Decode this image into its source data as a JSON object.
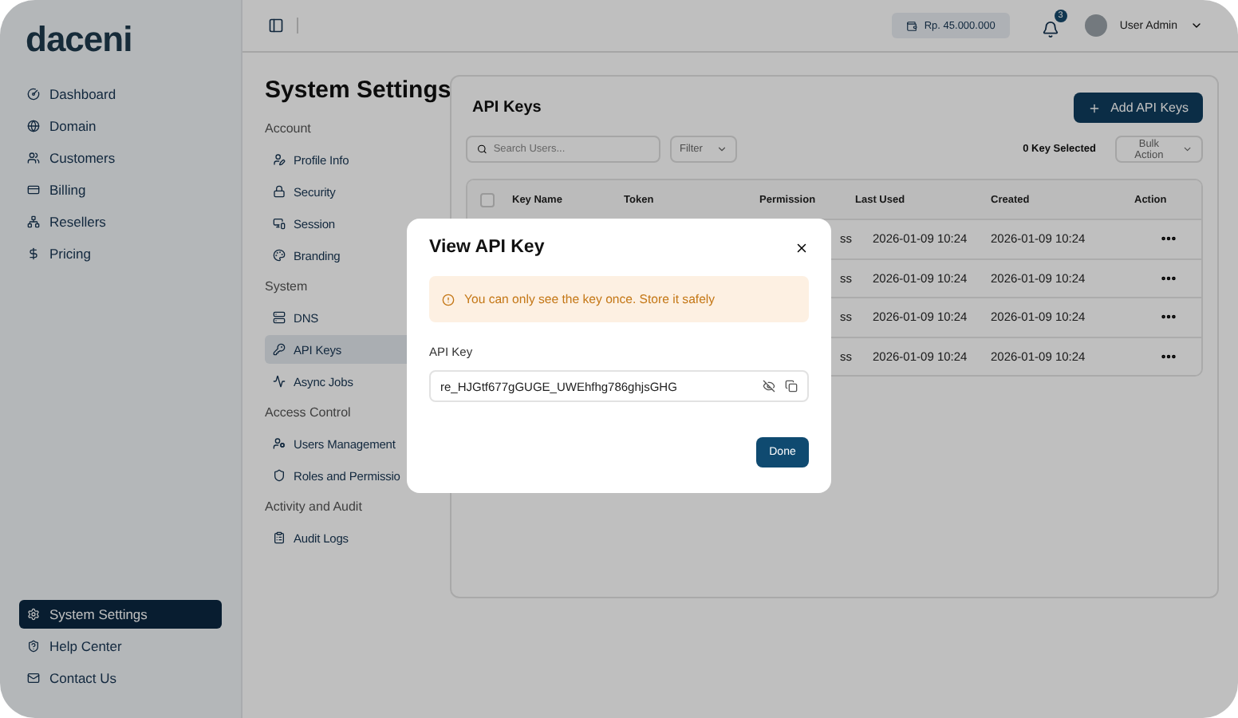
{
  "sidebar": {
    "logo": "daceni",
    "items": [
      {
        "label": "Dashboard",
        "selected": false
      },
      {
        "label": "Domain",
        "selected": false
      },
      {
        "label": "Customers",
        "selected": false
      },
      {
        "label": "Billing",
        "selected": false
      },
      {
        "label": "Resellers",
        "selected": false
      },
      {
        "label": "Pricing",
        "selected": false
      }
    ],
    "bottom_items": [
      {
        "label": "System Settings",
        "selected": true
      },
      {
        "label": "Help Center",
        "selected": false
      },
      {
        "label": "Contact Us",
        "selected": false
      }
    ]
  },
  "header": {
    "balance": "Rp. 45.000.000",
    "notification_count": "3",
    "user": "User Admin"
  },
  "settings_nav": {
    "title": "System Settings",
    "groups": [
      {
        "title": "Account",
        "items": [
          {
            "label": "Profile Info",
            "selected": false
          },
          {
            "label": "Security",
            "selected": false
          },
          {
            "label": "Session",
            "selected": false
          },
          {
            "label": "Branding",
            "selected": false
          }
        ]
      },
      {
        "title": "System",
        "items": [
          {
            "label": "DNS",
            "selected": false
          },
          {
            "label": "API Keys",
            "selected": true
          },
          {
            "label": "Async Jobs",
            "selected": false
          }
        ]
      },
      {
        "title": "Access Control",
        "items": [
          {
            "label": "Users Management",
            "selected": false
          },
          {
            "label": "Roles and Permissio",
            "selected": false
          }
        ]
      },
      {
        "title": "Activity and Audit",
        "items": [
          {
            "label": "Audit Logs",
            "selected": false
          }
        ]
      }
    ]
  },
  "panel": {
    "title": "API Keys",
    "add_button": "Add API Keys",
    "search": {
      "placeholder": "Search Users..."
    },
    "filter": "Filter",
    "selected_count": "0 Key Selected",
    "bulk_action": "Bulk Action",
    "table": {
      "all_checked": false,
      "columns": [
        "Key Name",
        "Token",
        "Permission",
        "Last Used",
        "Created",
        "Action"
      ],
      "rows": [
        {
          "permission": "ss",
          "last_used": "2026-01-09 10:24",
          "created": "2026-01-09 10:24"
        },
        {
          "permission": "ss",
          "last_used": "2026-01-09 10:24",
          "created": "2026-01-09 10:24"
        },
        {
          "permission": "ss",
          "last_used": "2026-01-09 10:24",
          "created": "2026-01-09 10:24"
        },
        {
          "permission": "ss",
          "last_used": "2026-01-09 10:24",
          "created": "2026-01-09 10:24"
        }
      ]
    }
  },
  "modal": {
    "title": "View API Key",
    "warning": "You can only see the key once. Store it safely",
    "field_label": "API Key",
    "value": "re_HJGtf677gGUGE_UWEhfhg786ghjsGHG",
    "done": "Done"
  }
}
